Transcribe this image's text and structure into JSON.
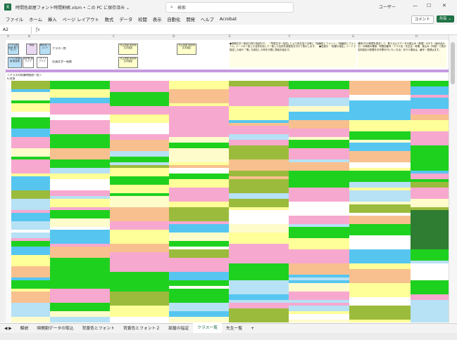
{
  "window": {
    "title": "時間色部屋フォント時間割帳.xlsm • この PC に保存済み ⌄",
    "search_placeholder": "検索",
    "user": "ユーザー",
    "minimize": "—",
    "maximize": "☐",
    "close": "✕"
  },
  "menu": {
    "items": [
      "ファイル",
      "ホーム",
      "挿入",
      "ページ レイアウト",
      "数式",
      "データ",
      "校閲",
      "表示",
      "自動化",
      "開発",
      "ヘルプ",
      "Acrobat"
    ],
    "comment": "コメント",
    "share": "共有 ⌄"
  },
  "formula": {
    "namebox": "A2",
    "fx": "ƒx"
  },
  "columns": [
    "A",
    "B",
    "C",
    "D",
    "E",
    "F",
    "G",
    "H"
  ],
  "sheet": {
    "btn_top1": "クラス別色部\n屋フォント",
    "btn_top2": "時間",
    "btn_top3": "教員色\nフォント",
    "label_class": "クラス一覧",
    "btn_std1": "クラス別色部\n屋反映",
    "btn_std2": "選択範\n囲クリア",
    "btn_std3": "フォント\nクリア",
    "label_select": "先頭文字一致数",
    "btn_mid1": "先生別部\n屋反映\n文字設定",
    "btn_mid2": "先生別部\n屋反映\n文字設定",
    "btn_mid3": "先生別部\n屋反映\n文字設定",
    "note_left": "●時間文字一致割り振り色部分下。　「所属文字一括割」により色を並べる時に「組番色とフォント」「組番色とフォント2」シートの一覧した名前を探して一致した名前を部屋色を付けて表示します。　●色部分　「部屋の指定」シートで指定した組や「場」を設定した時を行間に表組を組ます。",
    "note_right": "通常1行の時間を設定して、数十込んでデータの差込み（希望）のやり（組み合わせ）の時間の確保：時間割番号・クラス名・先生名・時間、差込み（外部）で表示名前設定の配置を手作業を行いたくなる）を行う場合は、番号・登録はます。",
    "section_label": "＜クラスの授業時間割一覧＞",
    "row_header": "行名前"
  },
  "tabs": [
    "解説",
    "時間割データの取込",
    "背景色とフォント",
    "背景色とフォント２",
    "部屋の指定",
    "クラス一覧",
    "先生一覧"
  ],
  "active_tab": "クラス一覧",
  "add_tab": "+",
  "colors": {
    "green": "#1fd11f",
    "pink": "#f7a8cf",
    "blue": "#56c6f0",
    "light_blue": "#b7e1f5",
    "yellow": "#ffff99",
    "cream": "#fffccc",
    "olive": "#9bbb3c",
    "dark_green": "#2e7d32",
    "orange": "#f8c08e",
    "white": "#ffffff",
    "excel_green": "#1e7145"
  }
}
